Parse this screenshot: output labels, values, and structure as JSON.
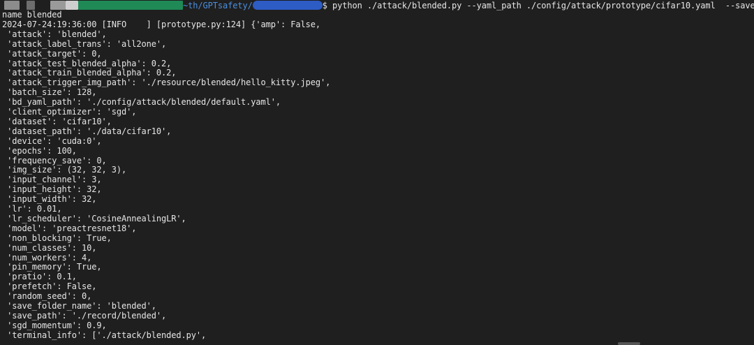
{
  "window": {
    "background": "#1f1f1f",
    "text_color": "#e6e6e6",
    "path_color": "#4a8fe0"
  },
  "prompt": {
    "path": "~th/GPTsafety/",
    "command": "$ python ./attack/blended.py --yaml_path ./config/attack/prototype/cifar10.yaml  --save_folder_"
  },
  "output": {
    "lines": [
      "name blended",
      "2024-07-24:19:36:00 [INFO    ] [prototype.py:124] {'amp': False,",
      " 'attack': 'blended',",
      " 'attack_label_trans': 'all2one',",
      " 'attack_target': 0,",
      " 'attack_test_blended_alpha': 0.2,",
      " 'attack_train_blended_alpha': 0.2,",
      " 'attack_trigger_img_path': './resource/blended/hello_kitty.jpeg',",
      " 'batch_size': 128,",
      " 'bd_yaml_path': './config/attack/blended/default.yaml',",
      " 'client_optimizer': 'sgd',",
      " 'dataset': 'cifar10',",
      " 'dataset_path': './data/cifar10',",
      " 'device': 'cuda:0',",
      " 'epochs': 100,",
      " 'frequency_save': 0,",
      " 'img_size': (32, 32, 3),",
      " 'input_channel': 3,",
      " 'input_height': 32,",
      " 'input_width': 32,",
      " 'lr': 0.01,",
      " 'lr_scheduler': 'CosineAnnealingLR',",
      " 'model': 'preactresnet18',",
      " 'non_blocking': True,",
      " 'num_classes': 10,",
      " 'num_workers': 4,",
      " 'pin_memory': True,",
      " 'pratio': 0.1,",
      " 'prefetch': False,",
      " 'random_seed': 0,",
      " 'save_folder_name': 'blended',",
      " 'save_path': './record/blended',",
      " 'sgd_momentum': 0.9,",
      " 'terminal_info': ['./attack/blended.py',"
    ]
  }
}
